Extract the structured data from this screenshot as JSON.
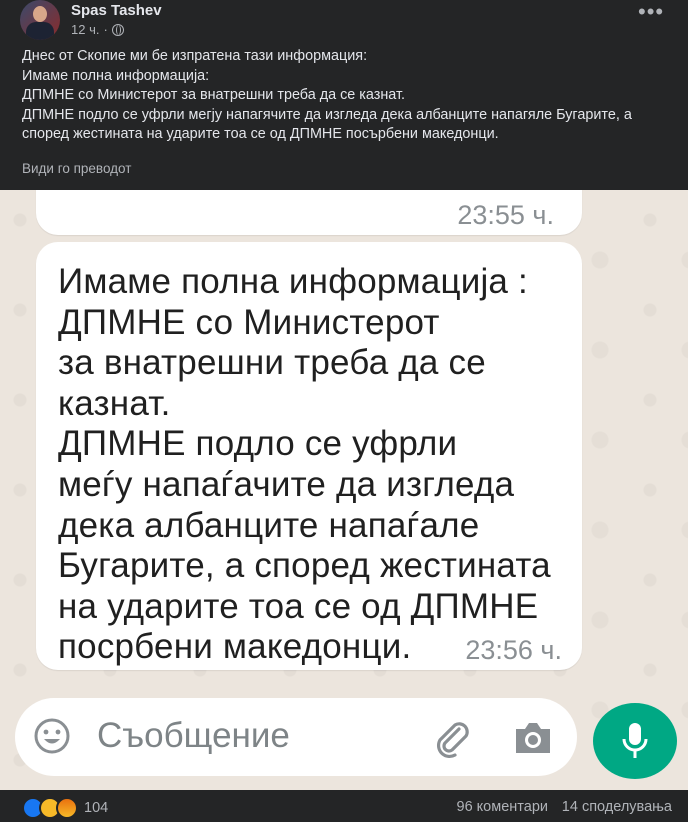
{
  "post": {
    "author": "Spas Tashev",
    "time": "12 ч.",
    "time_separator": "·",
    "privacy_icon": "globe-icon",
    "lines": [
      "Днес от Скопие ми бе изпратена тази информация:",
      "Имаме полна информација:",
      "ДПМНЕ со Министерот за внатрешни треба да се казнат.",
      "ДПМНЕ подло се уфрли мегју напагячите да изгледа дека албанците напагяле Бугарите, а според жестината на ударите тоа се од ДПМНЕ посърбени македонци."
    ],
    "translate_label": "Види го преводот"
  },
  "screenshot": {
    "bubble1_time": "23:55 ч.",
    "message_lines": [
      "Имаме полна информација :",
      "ДПМНЕ со Министерот",
      "за внатрешни треба да се",
      "казнат.",
      "ДПМНЕ подло се уфрли",
      "меѓу напаѓачите да изгледа",
      "дека албанците напаѓале",
      "Бугарите, а според жестината",
      "на ударите тоа се од ДПМНЕ",
      "посрбени македонци."
    ],
    "bubble2_time": "23:56 ч.",
    "input_placeholder": "Съобщение",
    "accent_color": "#00a884"
  },
  "footer": {
    "reaction_count": "104",
    "comments": "96 коментари",
    "shares": "14 споделувања"
  }
}
